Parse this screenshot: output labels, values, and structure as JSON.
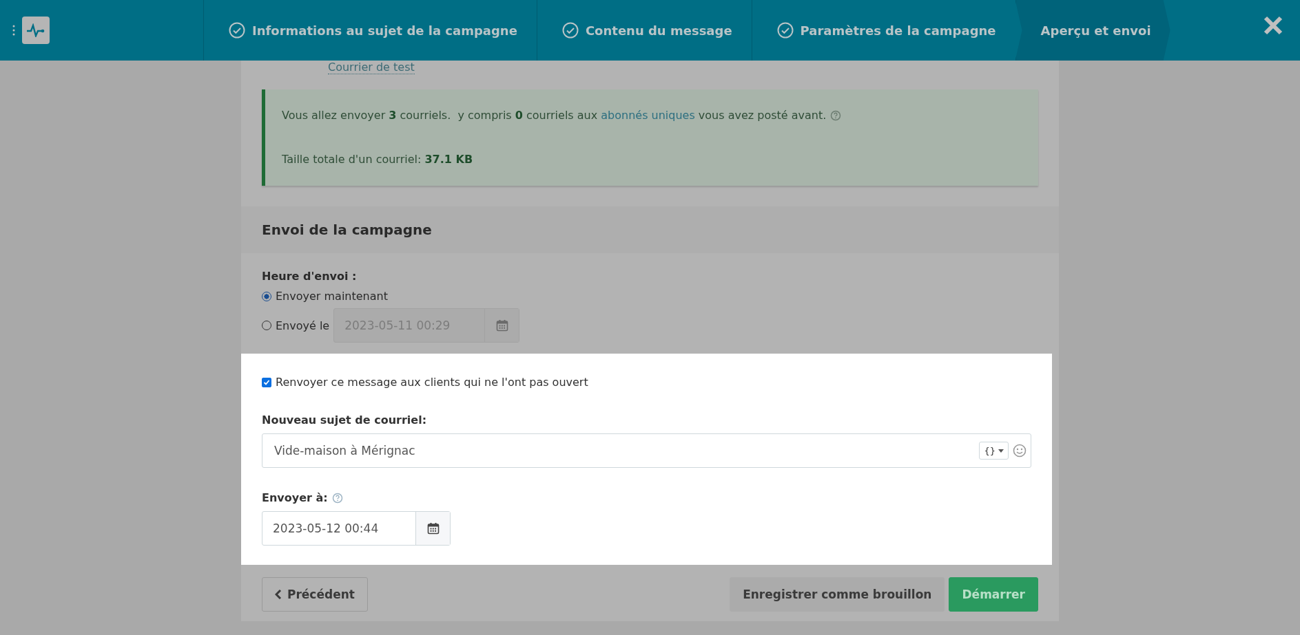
{
  "header": {
    "steps": [
      {
        "label": "Informations au sujet de la campagne",
        "done": true,
        "selected": false
      },
      {
        "label": "Contenu du message",
        "done": true,
        "selected": false
      },
      {
        "label": "Paramètres de la campagne",
        "done": true,
        "selected": false
      },
      {
        "label": "Aperçu et envoi",
        "done": false,
        "selected": true
      }
    ]
  },
  "test_link": "Courrier de test",
  "summary": {
    "before": "Vous allez envoyer **3** courriels.  y compris **0** courriels aux ",
    "link": "abonnés uniques",
    "after": " vous avez posté avant.",
    "size": "Taille totale d'un courriel: **37.1 KB**"
  },
  "section_title": "Envoi de la campagne",
  "send_time": {
    "label": "Heure d'envoi :",
    "options": [
      {
        "label": "Envoyer maintenant",
        "selected": true
      },
      {
        "label": "Envoyé le",
        "selected": false,
        "value": "2023-05-11 00:29"
      }
    ]
  },
  "resend": {
    "label": "Renvoyer ce message aux clients qui ne l'ont pas ouvert",
    "checked": true
  },
  "subject": {
    "label": "Nouveau sujet de courriel:",
    "value": "Vide-maison à Mérignac",
    "token_button": "{}"
  },
  "send_at": {
    "label": "Envoyer à:",
    "value": "2023-05-12 00:44"
  },
  "buttons": {
    "previous": "Précédent",
    "draft": "Enregistrer comme brouillon",
    "start": "Démarrer"
  }
}
